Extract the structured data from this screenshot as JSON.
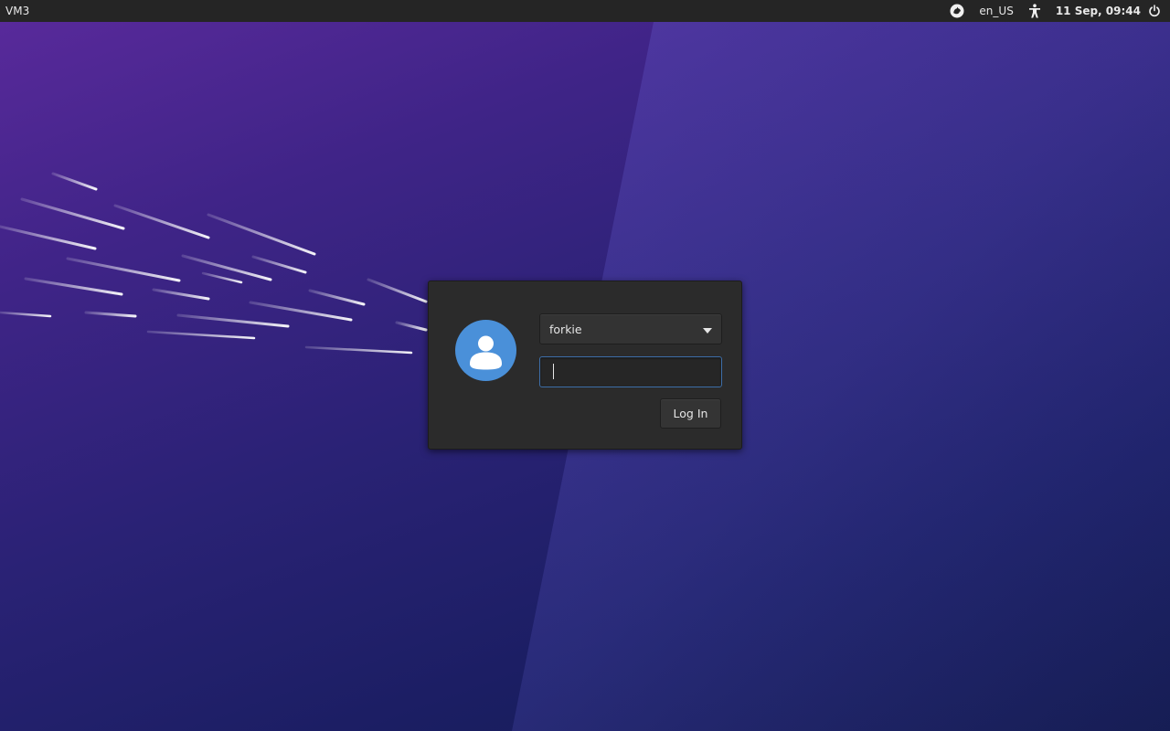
{
  "panel": {
    "hostname": "VM3",
    "indicators": [
      {
        "name": "session-icon"
      },
      {
        "name": "keyboard-layout",
        "label": "en_US"
      },
      {
        "name": "accessibility-icon"
      }
    ],
    "keyboard_layout": "en_US",
    "clock": "11 Sep, 09:44",
    "power_icon": "power-icon"
  },
  "login": {
    "avatar_icon": "user-avatar-icon",
    "selected_user": "forkie",
    "password_value": "",
    "login_label": "Log In"
  },
  "colors": {
    "panel_bg": "#252525",
    "dialog_bg": "#2b2b2b",
    "avatar_bg": "#4a90d9",
    "focus_border": "#3d6ea8",
    "wallpaper_top": "#5a2a9c",
    "wallpaper_bottom": "#141a4e"
  }
}
